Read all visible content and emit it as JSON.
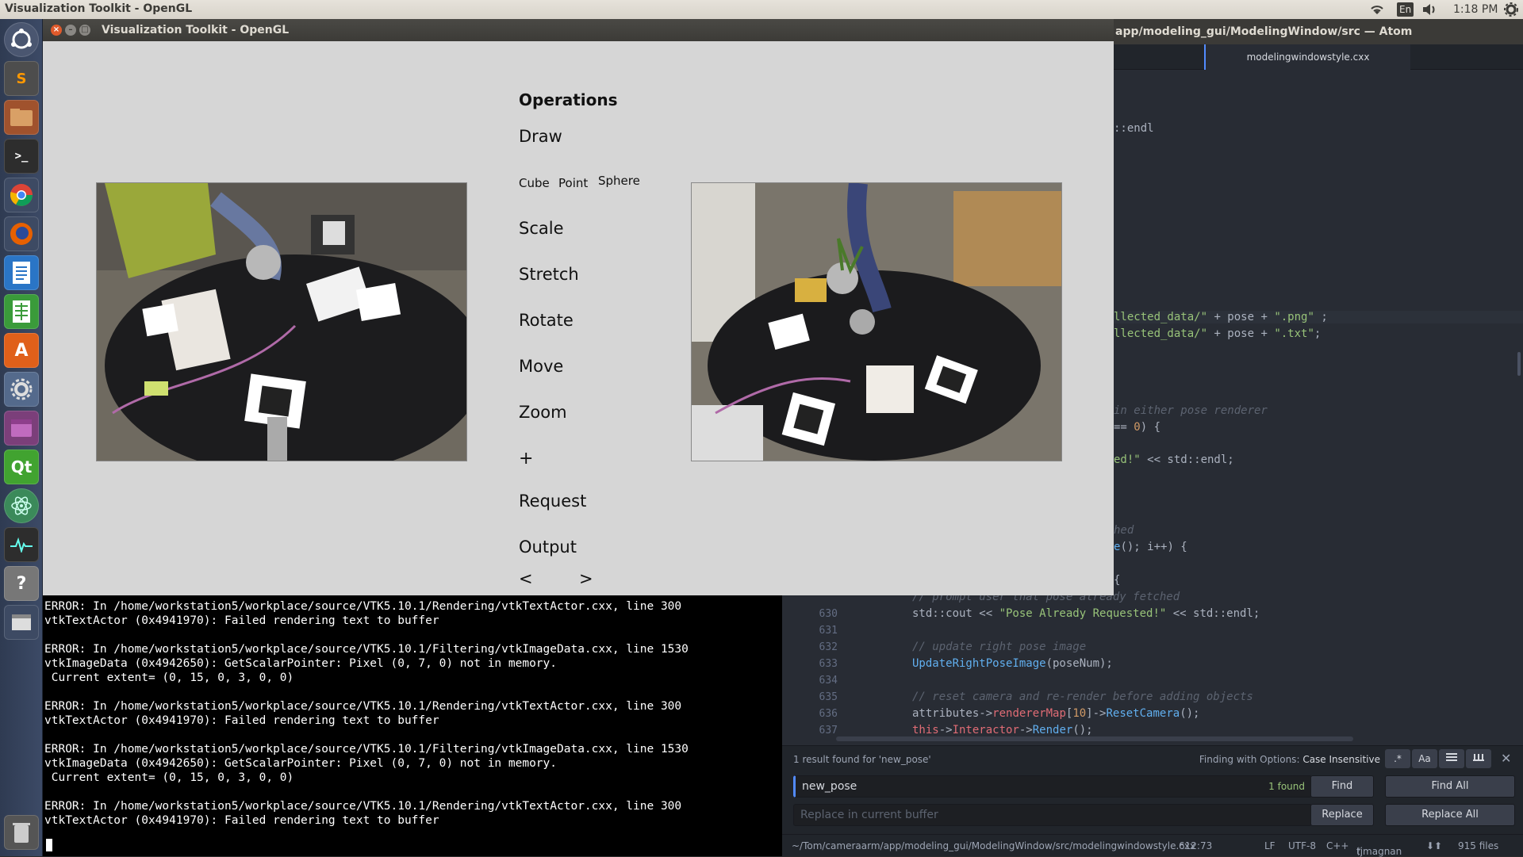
{
  "topbar": {
    "window_title": "Visualization Toolkit - OpenGL",
    "lang": "En",
    "time": "1:18 PM"
  },
  "vtk": {
    "title": "Visualization Toolkit - OpenGL",
    "heading": "Operations",
    "draw": "Draw",
    "shapes": [
      "Cube",
      "Point",
      "Sphere"
    ],
    "scale": "Scale",
    "stretch": "Stretch",
    "rotate": "Rotate",
    "move": "Move",
    "zoom": "Zoom",
    "plus": "+",
    "request": "Request",
    "output": "Output",
    "prev": "<",
    "next": ">"
  },
  "atom": {
    "title": "app/modeling_gui/ModelingWindow/src — Atom",
    "tab": "modelingwindowstyle.cxx",
    "line_numbers": [
      "630",
      "631",
      "632",
      "633",
      "634",
      "635",
      "636",
      "637"
    ],
    "find": {
      "result": "1 result found for 'new_pose'",
      "options_label": "Finding with Options:",
      "options_value": "Case Insensitive",
      "opt_regex": ".*",
      "opt_case": "Aa",
      "search_value": "new_pose",
      "found": "1 found",
      "find_btn": "Find",
      "find_all_btn": "Find All",
      "replace_placeholder": "Replace in current buffer",
      "replace_btn": "Replace",
      "replace_all_btn": "Replace All"
    },
    "status": {
      "path": "~/Tom/cameraarm/app/modeling_gui/ModelingWindow/src/modelingwindowstyle.cxx",
      "cursor": "612:73",
      "eol": "LF",
      "encoding": "UTF-8",
      "grammar": "C++",
      "branch": "tjmagnan",
      "files": "915 files"
    }
  },
  "terminal": {
    "lines": [
      "ERROR: In /home/workstation5/workplace/source/VTK5.10.1/Rendering/vtkTextActor.cxx, line 300",
      "vtkTextActor (0x4941970): Failed rendering text to buffer",
      "",
      "ERROR: In /home/workstation5/workplace/source/VTK5.10.1/Filtering/vtkImageData.cxx, line 1530",
      "vtkImageData (0x4942650): GetScalarPointer: Pixel (0, 7, 0) not in memory.",
      " Current extent= (0, 15, 0, 3, 0, 0)",
      "",
      "ERROR: In /home/workstation5/workplace/source/VTK5.10.1/Rendering/vtkTextActor.cxx, line 300",
      "vtkTextActor (0x4941970): Failed rendering text to buffer",
      "",
      "ERROR: In /home/workstation5/workplace/source/VTK5.10.1/Filtering/vtkImageData.cxx, line 1530",
      "vtkImageData (0x4942650): GetScalarPointer: Pixel (0, 7, 0) not in memory.",
      " Current extent= (0, 15, 0, 3, 0, 0)",
      "",
      "ERROR: In /home/workstation5/workplace/source/VTK5.10.1/Rendering/vtkTextActor.cxx, line 300",
      "vtkTextActor (0x4941970): Failed rendering text to buffer"
    ]
  },
  "colors": {
    "accent": "#528bff",
    "editor_bg": "#282c34",
    "terminal_bg": "#000000",
    "vtk_bg": "#d6d6d6"
  }
}
